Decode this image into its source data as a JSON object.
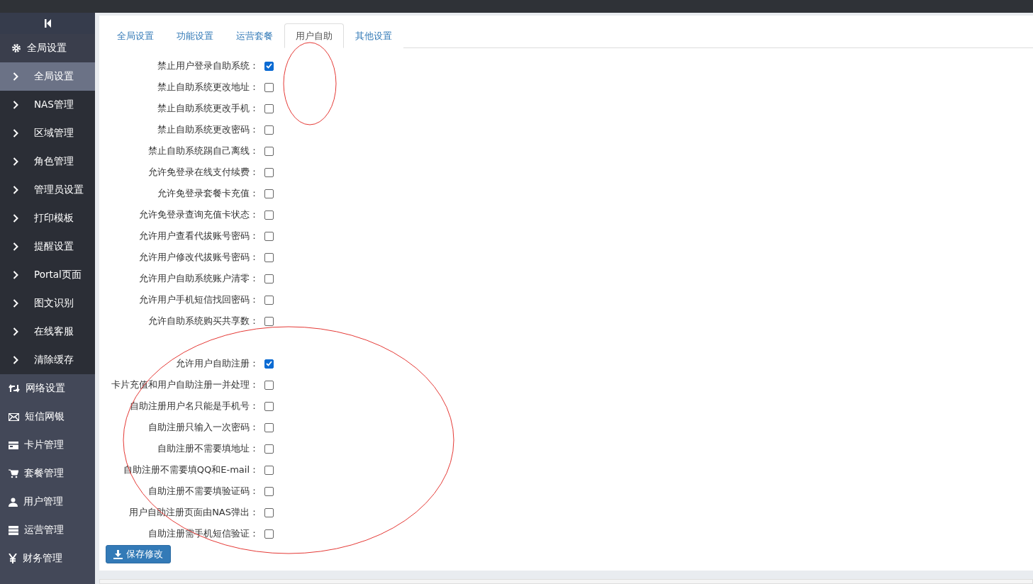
{
  "sidebar": {
    "items": [
      {
        "label": "全局设置",
        "expanded": true,
        "children": [
          {
            "label": "全局设置",
            "selected": true
          },
          {
            "label": "NAS管理",
            "selected": false
          },
          {
            "label": "区域管理",
            "selected": false
          },
          {
            "label": "角色管理",
            "selected": false
          },
          {
            "label": "管理员设置",
            "selected": false
          },
          {
            "label": "打印模板",
            "selected": false
          },
          {
            "label": "提醒设置",
            "selected": false
          },
          {
            "label": "Portal页面",
            "selected": false
          },
          {
            "label": "图文识别",
            "selected": false
          },
          {
            "label": "在线客服",
            "selected": false
          },
          {
            "label": "清除缓存",
            "selected": false
          }
        ]
      },
      {
        "label": "网络设置",
        "expanded": false
      },
      {
        "label": "短信网银",
        "expanded": false
      },
      {
        "label": "卡片管理",
        "expanded": false
      },
      {
        "label": "套餐管理",
        "expanded": false
      },
      {
        "label": "用户管理",
        "expanded": false
      },
      {
        "label": "运营管理",
        "expanded": false
      },
      {
        "label": "财务管理",
        "expanded": false
      }
    ]
  },
  "tabs": [
    {
      "label": "全局设置",
      "selected": false
    },
    {
      "label": "功能设置",
      "selected": false
    },
    {
      "label": "运营套餐",
      "selected": false
    },
    {
      "label": "用户自助",
      "selected": true,
      "circled": true
    },
    {
      "label": "其他设置",
      "selected": false
    }
  ],
  "groups": [
    {
      "options": [
        {
          "label": "禁止用户登录自助系统：",
          "checked": true
        },
        {
          "label": "禁止自助系统更改地址：",
          "checked": false
        },
        {
          "label": "禁止自助系统更改手机：",
          "checked": false
        },
        {
          "label": "禁止自助系统更改密码：",
          "checked": false
        },
        {
          "label": "禁止自助系统踢自己离线：",
          "checked": false
        },
        {
          "label": "允许免登录在线支付续费：",
          "checked": false
        },
        {
          "label": "允许免登录套餐卡充值：",
          "checked": false
        },
        {
          "label": "允许免登录查询充值卡状态：",
          "checked": false
        },
        {
          "label": "允许用户查看代拔账号密码：",
          "checked": false
        },
        {
          "label": "允许用户修改代拔账号密码：",
          "checked": false
        },
        {
          "label": "允许用户自助系统账户清零：",
          "checked": false
        },
        {
          "label": "允许用户手机短信找回密码：",
          "checked": false
        },
        {
          "label": "允许自助系统购买共享数：",
          "checked": false
        }
      ]
    },
    {
      "circled": true,
      "options": [
        {
          "label": "允许用户自助注册：",
          "checked": true
        },
        {
          "label": "卡片充值和用户自助注册一并处理：",
          "checked": false
        },
        {
          "label": "自助注册用户名只能是手机号：",
          "checked": false
        },
        {
          "label": "自助注册只输入一次密码：",
          "checked": false
        },
        {
          "label": "自助注册不需要填地址：",
          "checked": false
        },
        {
          "label": "自助注册不需要填QQ和E-mail：",
          "checked": false
        },
        {
          "label": "自助注册不需要填验证码：",
          "checked": false
        },
        {
          "label": "用户自助注册页面由NAS弹出：",
          "checked": false
        },
        {
          "label": "自助注册需手机短信验证：",
          "checked": false
        }
      ]
    }
  ],
  "save_button": {
    "label": "保存修改"
  }
}
